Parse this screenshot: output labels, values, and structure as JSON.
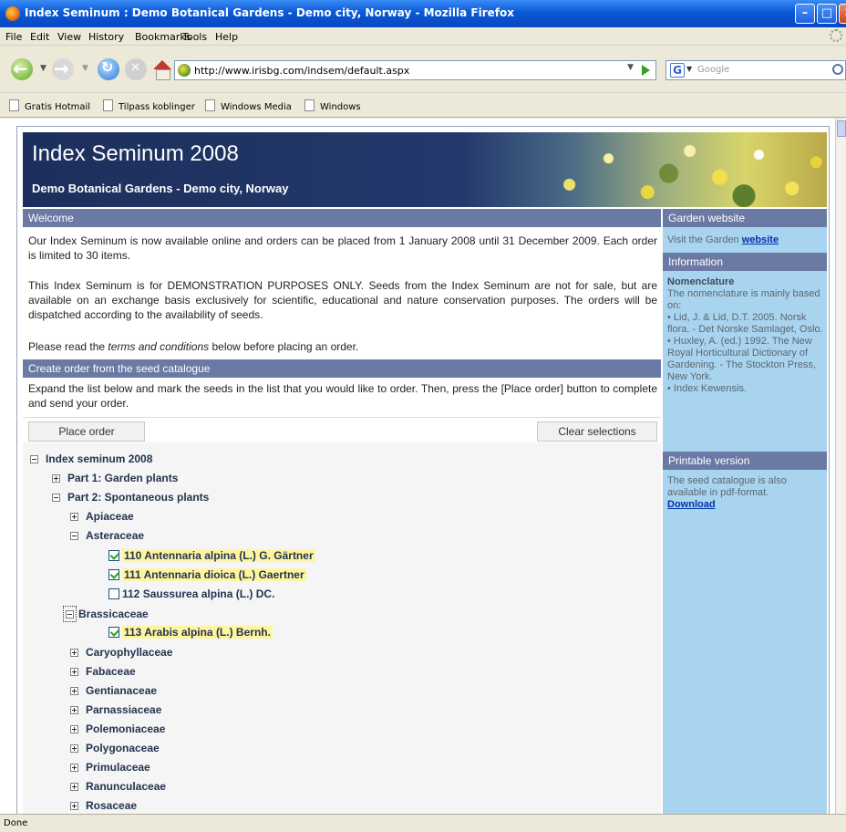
{
  "window": {
    "title": "Index Seminum : Demo Botanical Gardens - Demo city, Norway - Mozilla Firefox"
  },
  "menu": [
    "File",
    "Edit",
    "View",
    "History",
    "Bookmarks",
    "Tools",
    "Help"
  ],
  "nav": {
    "url": "http://www.irisbg.com/indsem/default.aspx",
    "search_placeholder": "Google"
  },
  "bookmarks": [
    "Gratis Hotmail",
    "Tilpass koblinger",
    "Windows Media",
    "Windows"
  ],
  "header": {
    "title": "Index Seminum 2008",
    "subtitle": "Demo Botanical Gardens - Demo city, Norway"
  },
  "welcome": {
    "heading": "Welcome",
    "p1": "Our Index Seminum is now available online and orders can be placed from 1 January 2008 until 31 December 2009. Each order is limited to 30 items.",
    "p2": "This Index Seminum is for DEMONSTRATION PURPOSES ONLY. Seeds from the Index Seminum are not for sale, but are available on an exchange basis exclusively for scientific, educational and nature conservation purposes. The orders will be dispatched according to the availability of seeds.",
    "p3_before": "Please read the ",
    "p3_em": "terms and conditions",
    "p3_after": " below before placing an order."
  },
  "order": {
    "heading": "Create order from the seed catalogue",
    "instructions": "Expand the list below and mark the seeds in the list that you would like to order. Then, press the [Place order] button to complete and send your order.",
    "place_order": "Place order",
    "clear_selections": "Clear selections"
  },
  "tree": {
    "root": "Index seminum 2008",
    "part1": "Part 1: Garden plants",
    "part2": "Part 2: Spontaneous plants",
    "apiaceae": "Apiaceae",
    "asteraceae": "Asteraceae",
    "s110": "110 Antennaria alpina (L.) G. Gärtner",
    "s111": "111 Antennaria dioica (L.) Gaertner",
    "s112": "112 Saussurea alpina (L.) DC.",
    "brassicaceae": "Brassicaceae",
    "s113": "113 Arabis alpina (L.) Bernh.",
    "families": [
      "Caryophyllaceae",
      "Fabaceae",
      "Gentianaceae",
      "Parnassiaceae",
      "Polemoniaceae",
      "Polygonaceae",
      "Primulaceae",
      "Ranunculaceae",
      "Rosaceae"
    ],
    "checked": {
      "s110": true,
      "s111": true,
      "s112": false,
      "s113": true
    }
  },
  "sidebar": {
    "garden_heading": "Garden website",
    "garden_text": "Visit the Garden ",
    "garden_link": "website",
    "info_heading": "Information",
    "nomenclature_title": "Nomenclature",
    "nomenclature_lines": [
      "The nomenclature is mainly based on:",
      "• Lid, J. & Lid, D.T. 2005. Norsk flora. - Det Norske Samlaget, Oslo.",
      "• Huxley, A. (ed.) 1992. The New Royal Horticultural Dictionary of Gardening. - The Stockton Press, New York.",
      "• Index Kewensis."
    ],
    "printable_heading": "Printable version",
    "printable_text": "The seed catalogue is also available in pdf-format.",
    "download_link": "Download"
  },
  "status": "Done",
  "colors": {
    "section_header": "#6a7aa4",
    "sidebar_bg": "#a9d4ef",
    "banner_bg": "#1c2f5c",
    "highlight": "#fff5a0"
  }
}
